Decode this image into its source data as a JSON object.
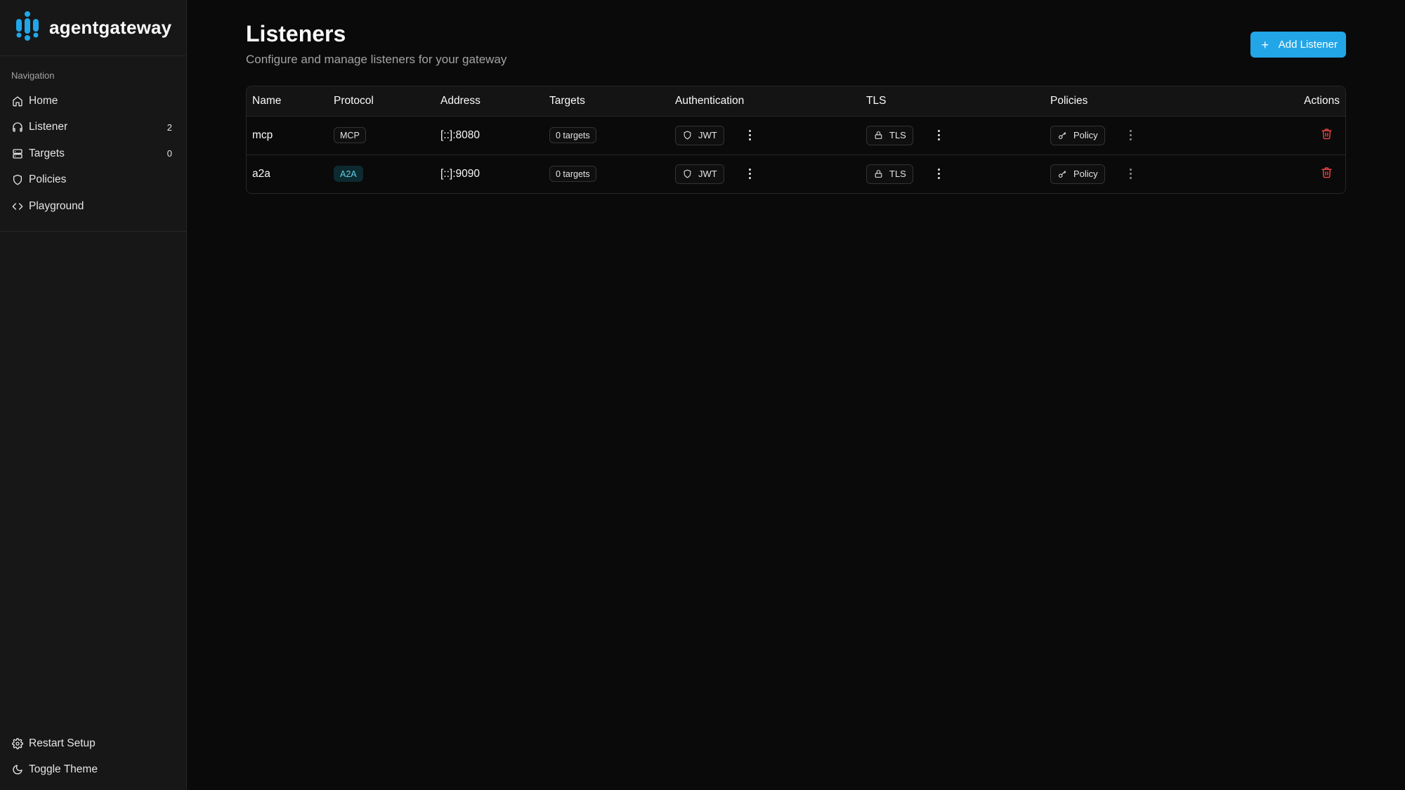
{
  "app": {
    "name": "agentgateway"
  },
  "sidebar": {
    "nav_heading": "Navigation",
    "items": [
      {
        "label": "Home",
        "icon": "home-icon",
        "count": ""
      },
      {
        "label": "Listener",
        "icon": "headphones-icon",
        "count": "2"
      },
      {
        "label": "Targets",
        "icon": "server-icon",
        "count": "0"
      },
      {
        "label": "Policies",
        "icon": "shield-icon",
        "count": ""
      },
      {
        "label": "Playground",
        "icon": "code-icon",
        "count": ""
      }
    ],
    "footer": [
      {
        "label": "Restart Setup",
        "icon": "gear-icon"
      },
      {
        "label": "Toggle Theme",
        "icon": "moon-icon"
      }
    ]
  },
  "page": {
    "title": "Listeners",
    "subtitle": "Configure and manage listeners for your gateway",
    "add_button": "Add Listener"
  },
  "table": {
    "headers": {
      "name": "Name",
      "protocol": "Protocol",
      "address": "Address",
      "targets": "Targets",
      "authentication": "Authentication",
      "tls": "TLS",
      "policies": "Policies",
      "actions": "Actions"
    },
    "rows": [
      {
        "name": "mcp",
        "protocol": "MCP",
        "address": "[::]:8080",
        "targets": "0 targets",
        "auth": "JWT",
        "tls": "TLS",
        "policy": "Policy"
      },
      {
        "name": "a2a",
        "protocol": "A2A",
        "address": "[::]:9090",
        "targets": "0 targets",
        "auth": "JWT",
        "tls": "TLS",
        "policy": "Policy"
      }
    ]
  },
  "colors": {
    "accent": "#22a6e8",
    "danger": "#ef4444",
    "a2a_badge_text": "#5fd3e6"
  }
}
